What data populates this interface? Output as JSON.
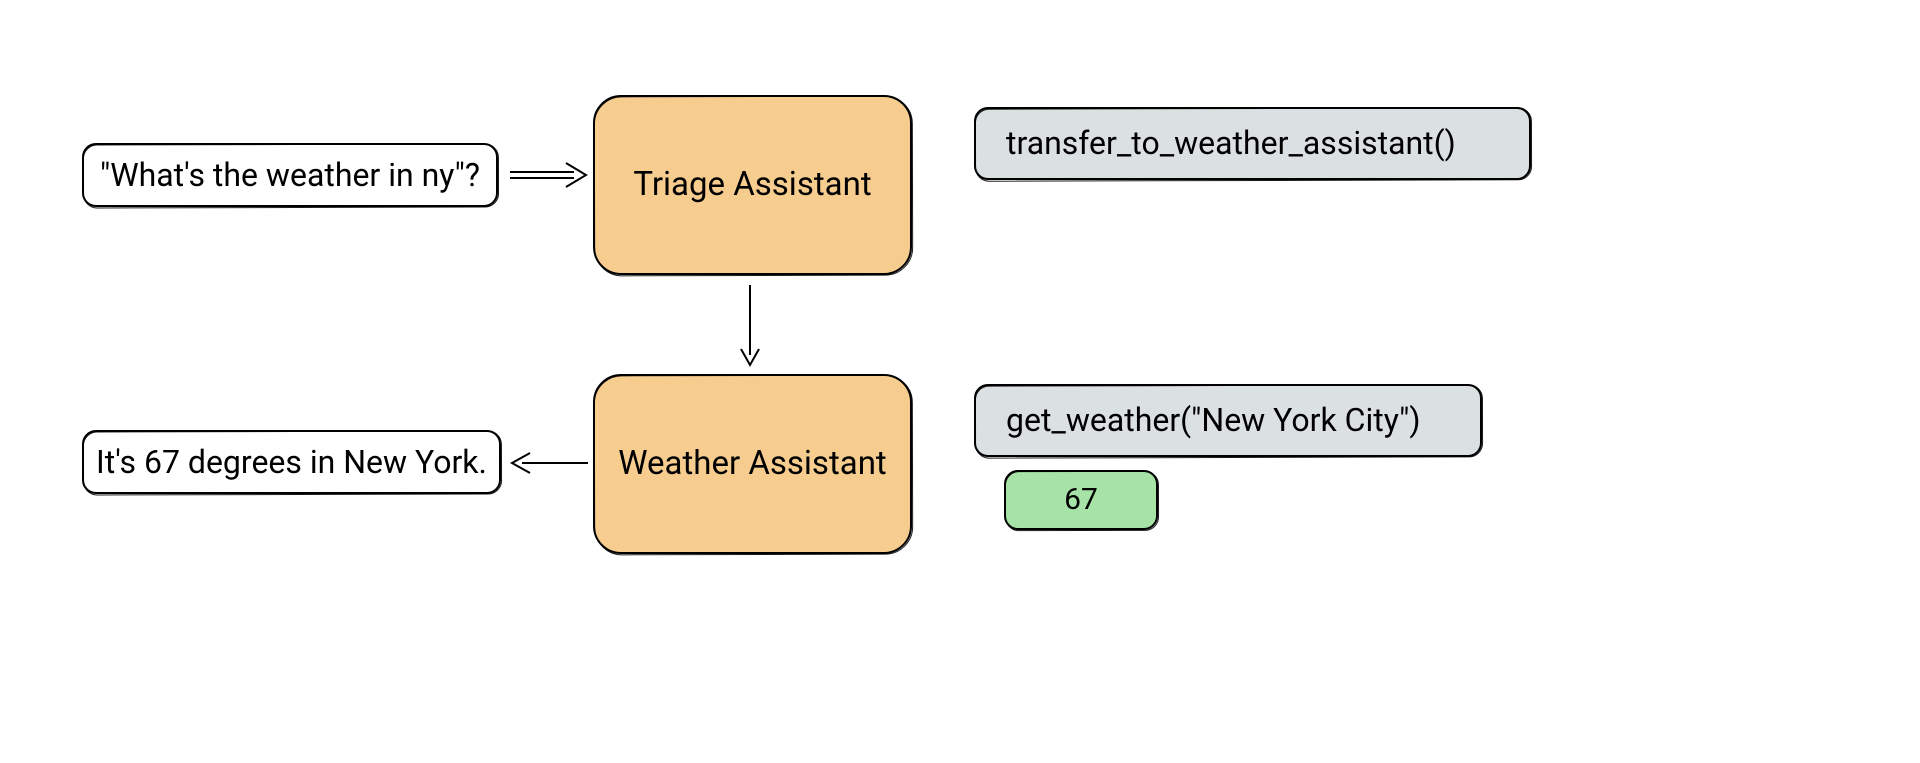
{
  "nodes": {
    "user_query": "\"What's the weather in ny\"?",
    "triage_assistant": "Triage Assistant",
    "weather_assistant": "Weather Assistant",
    "final_answer": "It's 67 degrees in New York.",
    "tool_transfer": "transfer_to_weather_assistant()",
    "tool_get_weather": "get_weather(\"New York City\")",
    "tool_result": "67"
  },
  "colors": {
    "assistant_fill": "#f6cd8f",
    "tool_fill": "#dbe0e2",
    "result_fill": "#a7e3a7",
    "stroke": "#000000"
  }
}
